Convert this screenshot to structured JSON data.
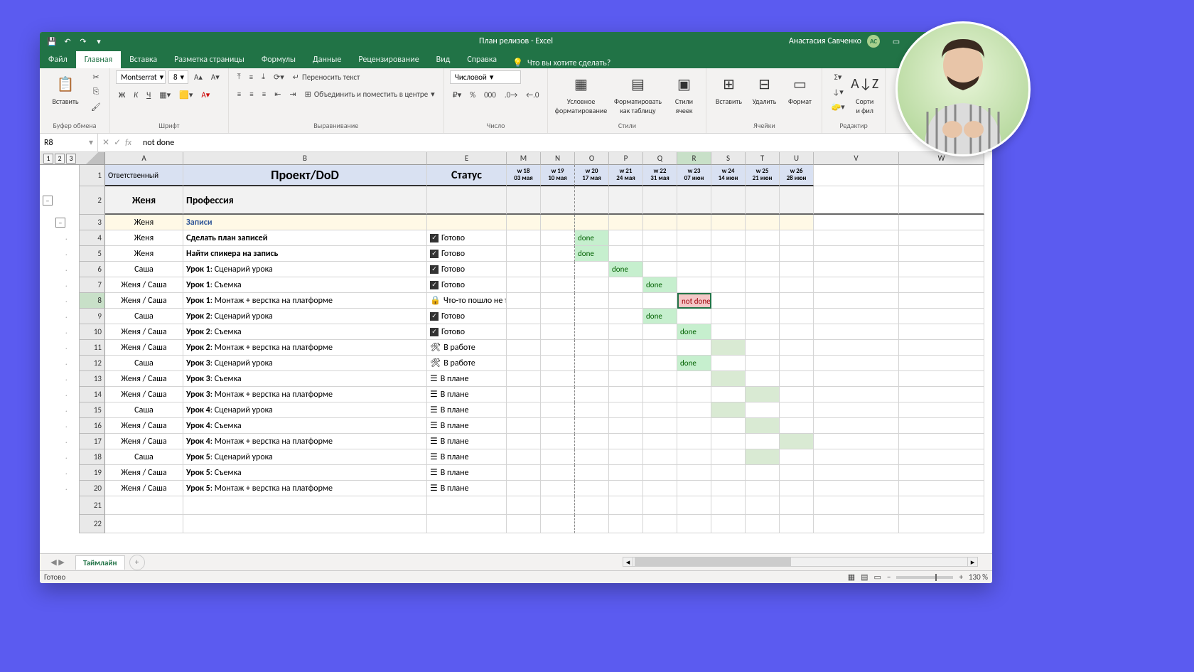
{
  "titlebar": {
    "title": "План релизов  -  Excel",
    "user_name": "Анастасия Савченко",
    "user_initials": "АС"
  },
  "ribbon_tabs": [
    "Файл",
    "Главная",
    "Вставка",
    "Разметка страницы",
    "Формулы",
    "Данные",
    "Рецензирование",
    "Вид",
    "Справка"
  ],
  "tell_me": "Что вы хотите сделать?",
  "ribbon": {
    "clipboard": {
      "paste": "Вставить",
      "label": "Буфер обмена"
    },
    "font": {
      "name": "Montserrat",
      "size": "8",
      "label": "Шрифт"
    },
    "alignment": {
      "wrap": "Переносить текст",
      "merge": "Объединить и поместить в центре",
      "label": "Выравнивание"
    },
    "number": {
      "format": "Числовой",
      "label": "Число"
    },
    "styles": {
      "cond": "Условное форматирование",
      "table": "Форматировать как таблицу",
      "cell": "Стили ячеек",
      "label": "Стили"
    },
    "cells": {
      "insert": "Вставить",
      "delete": "Удалить",
      "format": "Формат",
      "label": "Ячейки"
    },
    "editing": {
      "sort": "Сорти и фил",
      "label": "Редактир"
    }
  },
  "formula_bar": {
    "name_box": "R8",
    "value": "not done"
  },
  "columns": [
    "A",
    "B",
    "E",
    "M",
    "N",
    "O",
    "P",
    "Q",
    "R",
    "S",
    "T",
    "U",
    "V",
    "W"
  ],
  "selected_col": "R",
  "headers": {
    "A": "Ответственный",
    "B": "Проект/DoD",
    "E": "Статус"
  },
  "weeks": [
    {
      "col": "M",
      "w": "w 18",
      "d": "03  мая"
    },
    {
      "col": "N",
      "w": "w 19",
      "d": "10 мая"
    },
    {
      "col": "O",
      "w": "w 20",
      "d": "17 мая"
    },
    {
      "col": "P",
      "w": "w 21",
      "d": "24 мая"
    },
    {
      "col": "Q",
      "w": "w 22",
      "d": "31 мая"
    },
    {
      "col": "R",
      "w": "w 23",
      "d": "07 июн"
    },
    {
      "col": "S",
      "w": "w 24",
      "d": "14 июн"
    },
    {
      "col": "T",
      "w": "w 25",
      "d": "21 июн"
    },
    {
      "col": "U",
      "w": "w 26",
      "d": "28 июн"
    }
  ],
  "row2": {
    "A": "Женя",
    "B": "Профессия"
  },
  "row3": {
    "A": "Женя",
    "B": "Записи"
  },
  "rows": [
    {
      "n": 4,
      "owner": "Женя",
      "task": "Сделать план записей",
      "task_bold": true,
      "status_icon": "check",
      "status": "Готово",
      "marks": {
        "O": "done"
      }
    },
    {
      "n": 5,
      "owner": "Женя",
      "task": "Найти спикера на запись",
      "task_bold": true,
      "status_icon": "check",
      "status": "Готово",
      "marks": {
        "O": "done"
      }
    },
    {
      "n": 6,
      "owner": "Саша",
      "task": "Урок 1: Сценарий урока",
      "lesson": "Урок 1",
      "rest": ": Сценарий урока",
      "status_icon": "check",
      "status": "Готово",
      "marks": {
        "P": "done"
      }
    },
    {
      "n": 7,
      "owner": "Женя / Саша",
      "task": "Урок 1: Съемка",
      "lesson": "Урок 1",
      "rest": ": Съемка",
      "status_icon": "check",
      "status": "Готово",
      "marks": {
        "Q": "done"
      }
    },
    {
      "n": 8,
      "owner": "Женя / Саша",
      "task": "Урок 1: Монтаж + верстка на платформе",
      "lesson": "Урок 1",
      "rest": ": Монтаж + верстка на платформе",
      "status_icon": "lock",
      "status": "Что-то пошло не так",
      "marks": {
        "R": "not done"
      },
      "selected": true
    },
    {
      "n": 9,
      "owner": "Саша",
      "task": "Урок 2: Сценарий урока",
      "lesson": "Урок 2",
      "rest": ": Сценарий урока",
      "status_icon": "check",
      "status": "Готово",
      "marks": {
        "Q": "done"
      }
    },
    {
      "n": 10,
      "owner": "Женя / Саша",
      "task": "Урок 2: Съемка",
      "lesson": "Урок 2",
      "rest": ": Съемка",
      "status_icon": "check",
      "status": "Готово",
      "marks": {
        "R": "done"
      }
    },
    {
      "n": 11,
      "owner": "Женя / Саша",
      "task": "Урок 2: Монтаж + верстка на платформе",
      "lesson": "Урок 2",
      "rest": ": Монтаж + верстка на платформе",
      "status_icon": "tools",
      "status": "В работе",
      "sched": [
        "S"
      ]
    },
    {
      "n": 12,
      "owner": "Саша",
      "task": "Урок 3: Сценарий урока",
      "lesson": "Урок 3",
      "rest": ": Сценарий урока",
      "status_icon": "tools",
      "status": "В работе",
      "marks": {
        "R": "done"
      }
    },
    {
      "n": 13,
      "owner": "Женя / Саша",
      "task": "Урок 3: Съемка",
      "lesson": "Урок 3",
      "rest": ": Съемка",
      "status_icon": "plan",
      "status": "В плане",
      "sched": [
        "S"
      ]
    },
    {
      "n": 14,
      "owner": "Женя / Саша",
      "task": "Урок 3: Монтаж + верстка на платформе",
      "lesson": "Урок 3",
      "rest": ": Монтаж + верстка на платформе",
      "status_icon": "plan",
      "status": "В плане",
      "sched": [
        "T"
      ]
    },
    {
      "n": 15,
      "owner": "Саша",
      "task": "Урок 4: Сценарий урока",
      "lesson": "Урок 4",
      "rest": ": Сценарий урока",
      "status_icon": "plan",
      "status": "В плане",
      "sched": [
        "S"
      ]
    },
    {
      "n": 16,
      "owner": "Женя / Саша",
      "task": "Урок 4: Съемка",
      "lesson": "Урок 4",
      "rest": ": Съемка",
      "status_icon": "plan",
      "status": "В плане",
      "sched": [
        "T"
      ]
    },
    {
      "n": 17,
      "owner": "Женя / Саша",
      "task": "Урок 4: Монтаж + верстка на платформе",
      "lesson": "Урок 4",
      "rest": ": Монтаж + верстка на платформе",
      "status_icon": "plan",
      "status": "В плане",
      "sched": [
        "U"
      ]
    },
    {
      "n": 18,
      "owner": "Саша",
      "task": "Урок 5: Сценарий урока",
      "lesson": "Урок 5",
      "rest": ": Сценарий урока",
      "status_icon": "plan",
      "status": "В плане",
      "sched": [
        "T"
      ]
    },
    {
      "n": 19,
      "owner": "Женя / Саша",
      "task": "Урок 5: Съемка",
      "lesson": "Урок 5",
      "rest": ": Съемка",
      "status_icon": "plan",
      "status": "В плане"
    },
    {
      "n": 20,
      "owner": "Женя / Саша",
      "task": "Урок 5: Монтаж + верстка на платформе",
      "lesson": "Урок 5",
      "rest": ": Монтаж + верстка на платформе",
      "status_icon": "plan",
      "status": "В плане"
    }
  ],
  "empty_rows": [
    21,
    22
  ],
  "sheet_tab": "Таймлайн",
  "status_bar": {
    "ready": "Готово",
    "zoom": "130 %"
  }
}
